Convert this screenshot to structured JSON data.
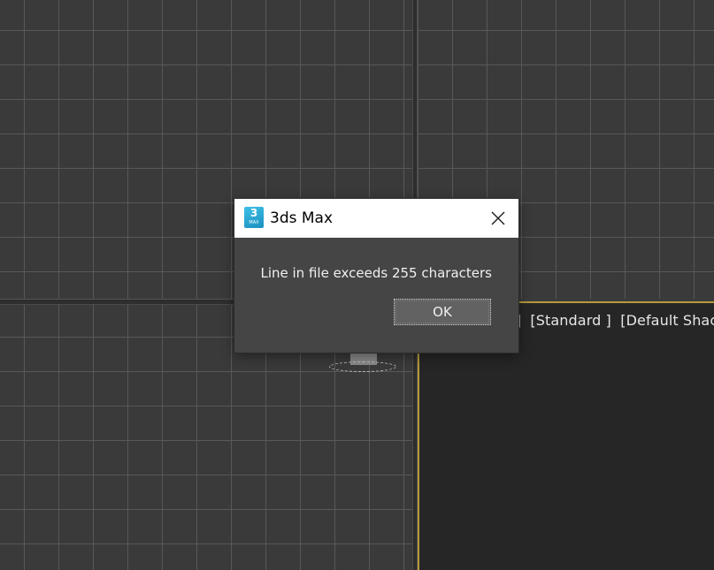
{
  "dialog": {
    "title": "3ds Max",
    "icon": {
      "name": "3ds-max-app-icon",
      "number": "3",
      "sub_label": "MAX"
    },
    "message": "Line in file exceeds 255 characters",
    "ok_label": "OK",
    "close_icon": "close-icon"
  },
  "viewports": {
    "bottom_right_label": "ve ]  [Standard ]  [Default Shac"
  },
  "colors": {
    "viewport_bg": "#3a3a3a",
    "grid_line": "#585858",
    "active_viewport_border": "#b59a3a",
    "dialog_body": "#454545",
    "titlebar": "#ffffff"
  }
}
